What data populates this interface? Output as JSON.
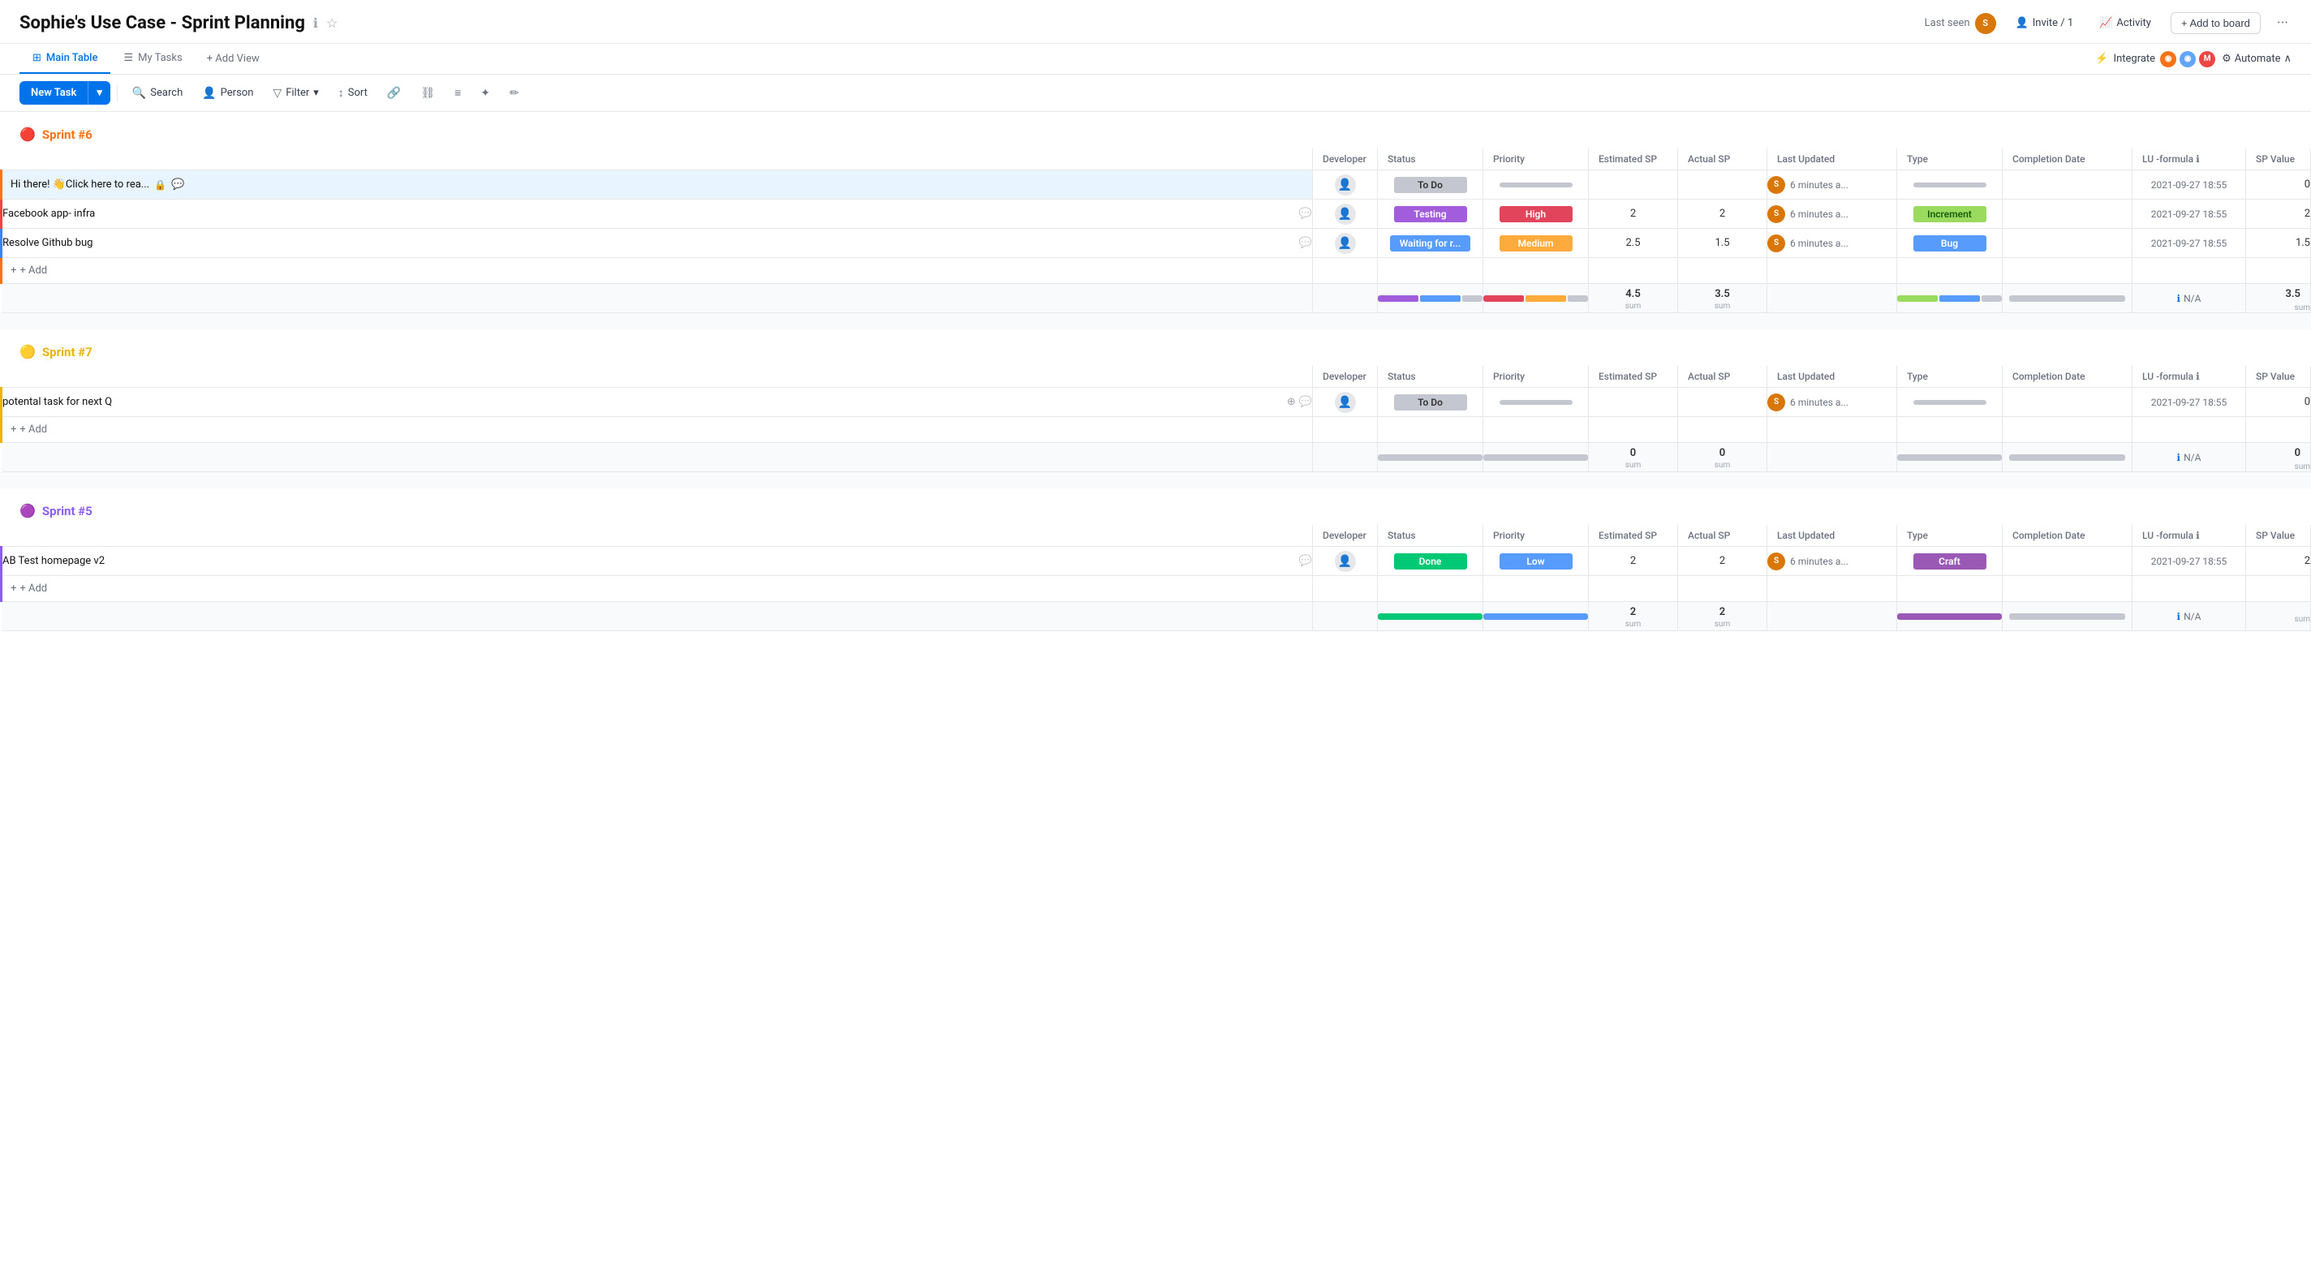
{
  "header": {
    "title": "Sophie's Use Case - Sprint Planning",
    "last_seen_label": "Last seen",
    "invite_label": "Invite / 1",
    "activity_label": "Activity",
    "add_to_board_label": "+ Add to board"
  },
  "tabs": {
    "main_table": "Main Table",
    "my_tasks": "My Tasks",
    "add_view": "+ Add View"
  },
  "integrate": {
    "label": "Integrate",
    "automate": "Automate"
  },
  "toolbar": {
    "new_task": "New Task",
    "search": "Search",
    "person": "Person",
    "filter": "Filter",
    "sort": "Sort"
  },
  "sprints": [
    {
      "id": "sprint6",
      "title": "Sprint #6",
      "color": "orange",
      "columns": [
        "Developer",
        "Status",
        "Priority",
        "Estimated SP",
        "Actual SP",
        "Last Updated",
        "Type",
        "Completion Date",
        "LU -formula",
        "SP Value"
      ],
      "tasks": [
        {
          "name": "Hi there! 👋Click here to rea...",
          "hasLock": true,
          "developer": "",
          "status": "To Do",
          "status_class": "status-todo",
          "priority": "",
          "priority_class": "priority-empty",
          "estimated_sp": "",
          "actual_sp": "",
          "last_updated": "6 minutes a...",
          "has_avatar": true,
          "type": "",
          "type_class": "type-empty",
          "completion_date": "",
          "lu_formula": "2021-09-27 18:55",
          "sp_value": "0",
          "row_class": "row-orange",
          "greeting": true
        },
        {
          "name": "Facebook app- infra",
          "developer": "",
          "status": "Testing",
          "status_class": "status-testing",
          "priority": "High",
          "priority_class": "priority-high",
          "estimated_sp": "2",
          "actual_sp": "2",
          "last_updated": "6 minutes a...",
          "has_avatar": true,
          "type": "Increment",
          "type_class": "type-increment",
          "completion_date": "",
          "lu_formula": "2021-09-27 18:55",
          "sp_value": "2",
          "row_class": "row-red"
        },
        {
          "name": "Resolve Github bug",
          "developer": "",
          "status": "Waiting for r...",
          "status_class": "status-waiting",
          "priority": "Medium",
          "priority_class": "priority-medium",
          "estimated_sp": "2.5",
          "actual_sp": "1.5",
          "last_updated": "6 minutes a...",
          "has_avatar": true,
          "type": "Bug",
          "type_class": "type-bug",
          "completion_date": "",
          "lu_formula": "2021-09-27 18:55",
          "sp_value": "1.5",
          "row_class": "row-blue"
        }
      ],
      "sum": {
        "estimated": "4.5",
        "actual": "3.5",
        "sp_value": "3.5",
        "status_bars": [
          {
            "color": "#a25ddc",
            "flex": 2
          },
          {
            "color": "#579bfc",
            "flex": 2
          },
          {
            "color": "#c5c7d0",
            "flex": 1
          }
        ],
        "priority_bars": [
          {
            "color": "#e2445c",
            "flex": 2
          },
          {
            "color": "#fdab3d",
            "flex": 2
          },
          {
            "color": "#c5c7d0",
            "flex": 1
          }
        ],
        "type_bars": [
          {
            "color": "#9adb5f",
            "flex": 2
          },
          {
            "color": "#579bfc",
            "flex": 2
          },
          {
            "color": "#c5c7d0",
            "flex": 1
          }
        ]
      }
    },
    {
      "id": "sprint7",
      "title": "Sprint #7",
      "color": "yellow",
      "columns": [
        "Developer",
        "Status",
        "Priority",
        "Estimated SP",
        "Actual SP",
        "Last Updated",
        "Type",
        "Completion Date",
        "LU -formula",
        "SP Value"
      ],
      "tasks": [
        {
          "name": "potental task for next Q",
          "developer": "",
          "status": "To Do",
          "status_class": "status-todo",
          "priority": "",
          "priority_class": "priority-empty",
          "estimated_sp": "",
          "actual_sp": "",
          "last_updated": "6 minutes a...",
          "has_avatar": true,
          "type": "",
          "type_class": "type-empty",
          "completion_date": "",
          "lu_formula": "2021-09-27 18:55",
          "sp_value": "0",
          "row_class": "row-yellow"
        }
      ],
      "sum": {
        "estimated": "0",
        "actual": "0",
        "sp_value": "0",
        "status_bars": [
          {
            "color": "#c5c7d0",
            "flex": 5
          }
        ],
        "priority_bars": [
          {
            "color": "#c5c7d0",
            "flex": 5
          }
        ],
        "type_bars": [
          {
            "color": "#c5c7d0",
            "flex": 5
          }
        ]
      }
    },
    {
      "id": "sprint5",
      "title": "Sprint #5",
      "color": "purple",
      "columns": [
        "Developer",
        "Status",
        "Priority",
        "Estimated SP",
        "Actual SP",
        "Last Updated",
        "Type",
        "Completion Date",
        "LU -formula",
        "SP Value"
      ],
      "tasks": [
        {
          "name": "AB Test homepage v2",
          "developer": "",
          "status": "Done",
          "status_class": "status-done",
          "priority": "Low",
          "priority_class": "priority-low",
          "estimated_sp": "2",
          "actual_sp": "2",
          "last_updated": "6 minutes a...",
          "has_avatar": true,
          "type": "Craft",
          "type_class": "type-craft",
          "completion_date": "",
          "lu_formula": "2021-09-27 18:55",
          "sp_value": "2",
          "row_class": "row-purple"
        }
      ],
      "sum": {
        "estimated": "2",
        "actual": "2",
        "sp_value": "",
        "status_bars": [
          {
            "color": "#00c875",
            "flex": 5
          }
        ],
        "priority_bars": [
          {
            "color": "#579bfc",
            "flex": 5
          }
        ],
        "type_bars": [
          {
            "color": "#9b59b6",
            "flex": 5
          }
        ]
      }
    }
  ]
}
